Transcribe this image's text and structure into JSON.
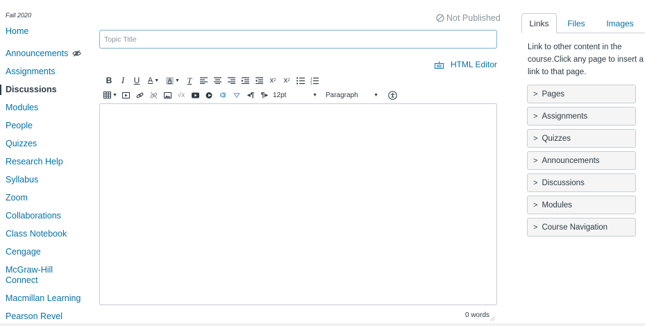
{
  "course_nav": {
    "term": "Fall 2020",
    "items": [
      {
        "label": "Home"
      },
      {
        "label": "Announcements"
      },
      {
        "label": "Assignments"
      },
      {
        "label": "Discussions"
      },
      {
        "label": "Modules"
      },
      {
        "label": "People"
      },
      {
        "label": "Quizzes"
      },
      {
        "label": "Research Help"
      },
      {
        "label": "Syllabus"
      },
      {
        "label": "Zoom"
      },
      {
        "label": "Collaborations"
      },
      {
        "label": "Class Notebook"
      },
      {
        "label": "Cengage"
      },
      {
        "label": "McGraw-Hill Connect"
      },
      {
        "label": "Macmillan Learning"
      },
      {
        "label": "Pearson Revel"
      }
    ],
    "active_item": "Discussions"
  },
  "editor": {
    "status": "Not Published",
    "title_placeholder": "Topic Title",
    "title_value": "",
    "html_editor_label": "HTML Editor",
    "font_size": "12pt",
    "block_format": "Paragraph",
    "word_count": "0 words"
  },
  "toolbar_icons": {
    "row1": [
      "bold-icon",
      "italic-icon",
      "underline-icon",
      "text-color-icon",
      "background-color-icon",
      "clear-formatting-icon",
      "align-left-icon",
      "align-center-icon",
      "align-right-icon",
      "indent-icon",
      "outdent-icon",
      "superscript-icon",
      "subscript-icon",
      "bullet-list-icon",
      "numbered-list-icon"
    ],
    "row2": [
      "table-icon",
      "media-icon",
      "link-icon",
      "unlink-icon",
      "image-icon",
      "equation-icon",
      "youtube-icon",
      "lti-tool-icon",
      "office365-icon",
      "google-drive-icon",
      "ltr-icon",
      "rtl-icon",
      "font-size-select",
      "format-select",
      "accessibility-icon"
    ]
  },
  "sidebar": {
    "tabs": [
      {
        "label": "Links",
        "active": true
      },
      {
        "label": "Files",
        "active": false
      },
      {
        "label": "Images",
        "active": false
      }
    ],
    "help_text": "Link to other content in the course.Click any page to insert a link to that page.",
    "sections": [
      {
        "label": "Pages"
      },
      {
        "label": "Assignments"
      },
      {
        "label": "Quizzes"
      },
      {
        "label": "Announcements"
      },
      {
        "label": "Discussions"
      },
      {
        "label": "Modules"
      },
      {
        "label": "Course Navigation"
      }
    ]
  },
  "colors": {
    "link": "#0770a3",
    "text": "#2d3b45",
    "muted": "#8b969e",
    "border": "#c7cdd1",
    "input_focus_border": "#7db3d4",
    "panel_bg": "#f5f5f5"
  }
}
